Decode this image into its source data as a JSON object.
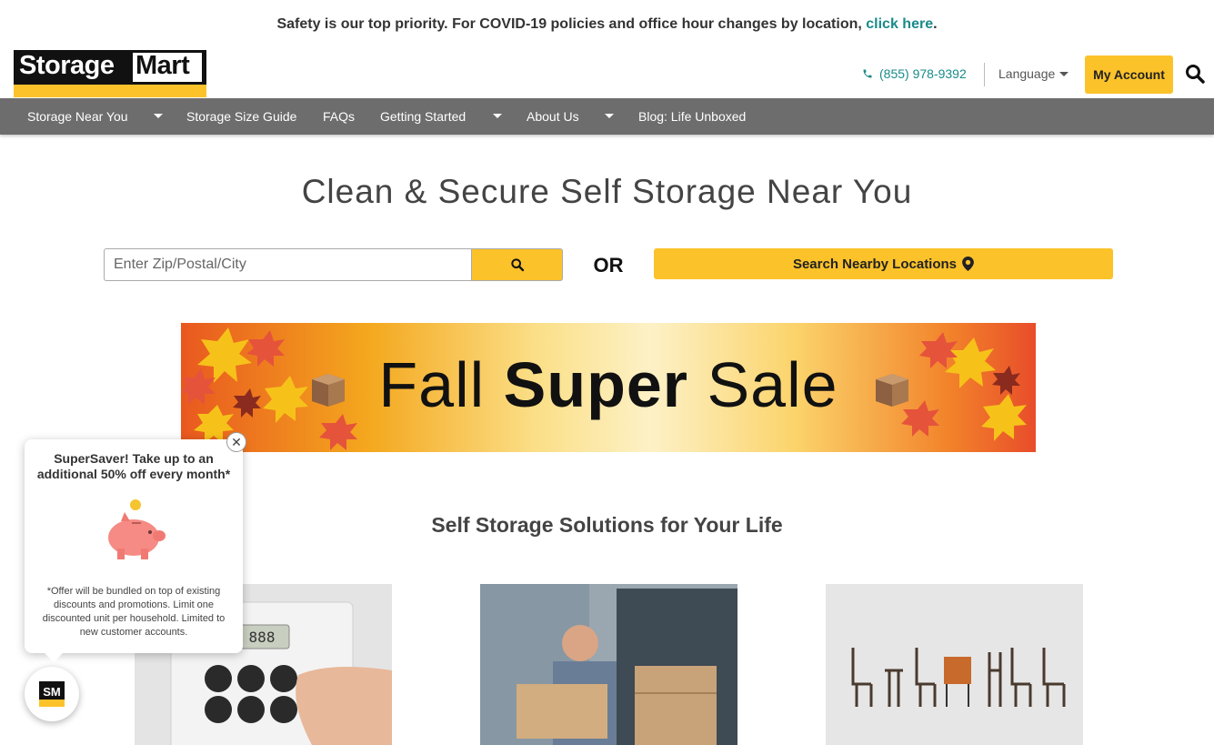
{
  "announcement": {
    "text": "Safety is our top priority. For COVID-19 policies and office hour changes by location, ",
    "link": "click here",
    "suffix": "."
  },
  "header": {
    "logo_part1": "Storage",
    "logo_part2": "Mart",
    "phone": "(855) 978-9392",
    "language_label": "Language",
    "account_label": "My Account"
  },
  "nav": {
    "items": [
      {
        "label": "Storage Near You",
        "has_dropdown": true
      },
      {
        "label": "Storage Size Guide",
        "has_dropdown": false
      },
      {
        "label": "FAQs",
        "has_dropdown": false
      },
      {
        "label": "Getting Started",
        "has_dropdown": true
      },
      {
        "label": "About Us",
        "has_dropdown": true
      },
      {
        "label": "Blog: Life Unboxed",
        "has_dropdown": false
      }
    ]
  },
  "hero": {
    "title": "Clean & Secure Self Storage Near You",
    "search_placeholder": "Enter Zip/Postal/City",
    "search_value": "",
    "or_text": "OR",
    "nearby_label": "Search Nearby Locations"
  },
  "banner": {
    "word1": "Fall ",
    "word2": "Super",
    "word3": " Sale"
  },
  "solutions": {
    "title": "Self Storage Solutions for Your Life",
    "cards": [
      {
        "image": "climate-control-keypad"
      },
      {
        "image": "man-carrying-box-storage-unit"
      },
      {
        "image": "row-of-chairs"
      }
    ]
  },
  "popup": {
    "title": "SuperSaver! Take up to an additional 50% off every month*",
    "note": "*Offer will be bundled on top of existing discounts and promotions. Limit one discounted unit per household. Limited to new customer accounts.",
    "close_glyph": "✕",
    "icon": "piggy-bank-icon"
  },
  "colors": {
    "brand_yellow": "#fcc22a",
    "nav_gray": "#6d6d6d",
    "link_teal": "#1a8a8a",
    "logo_black": "#111111"
  }
}
